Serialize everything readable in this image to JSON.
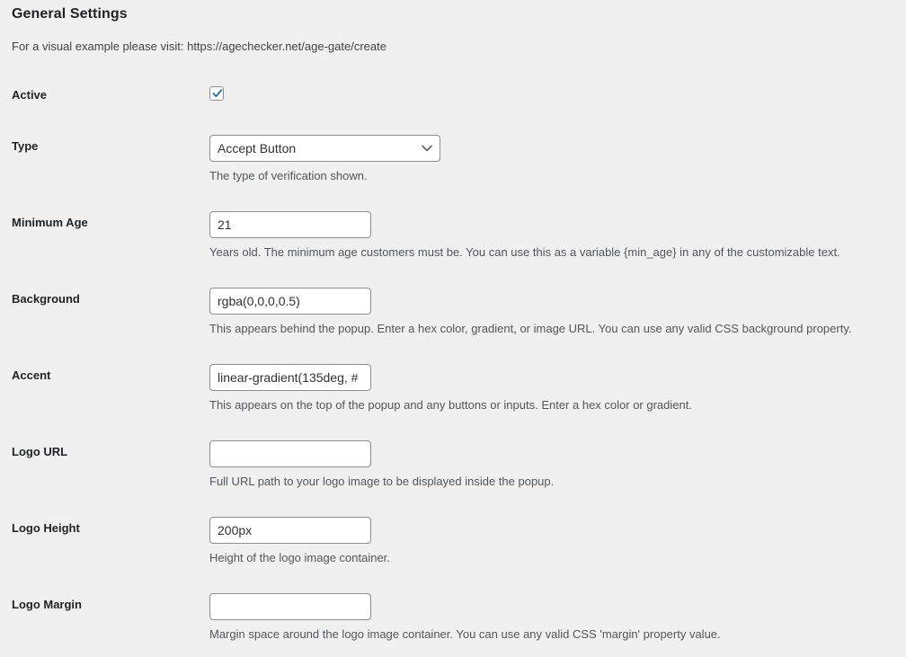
{
  "header": {
    "title": "General Settings",
    "subtitle": "For a visual example please visit: https://agechecker.net/age-gate/create"
  },
  "colors": {
    "background": "#f0f0f1",
    "label_text": "#1d2327",
    "description_text": "#50575e",
    "input_border": "#8c8f94",
    "input_background": "#ffffff",
    "checkbox_accent": "#2271b1"
  },
  "fields": [
    {
      "label": "Active",
      "control": "checkbox",
      "checked": true,
      "value": "",
      "description": ""
    },
    {
      "label": "Type",
      "control": "select",
      "value": "Accept Button",
      "options": [
        "Accept Button"
      ],
      "description": "The type of verification shown."
    },
    {
      "label": "Minimum Age",
      "control": "text",
      "value": "21",
      "placeholder": "",
      "description": "Years old. The minimum age customers must be. You can use this as a variable {min_age} in any of the customizable text."
    },
    {
      "label": "Background",
      "control": "text",
      "value": "rgba(0,0,0,0.5)",
      "placeholder": "",
      "description": "This appears behind the popup. Enter a hex color, gradient, or image URL. You can use any valid CSS background property."
    },
    {
      "label": "Accent",
      "control": "text",
      "value": "linear-gradient(135deg, #",
      "placeholder": "",
      "description": "This appears on the top of the popup and any buttons or inputs. Enter a hex color or gradient."
    },
    {
      "label": "Logo URL",
      "control": "text",
      "value": "",
      "placeholder": "",
      "description": "Full URL path to your logo image to be displayed inside the popup."
    },
    {
      "label": "Logo Height",
      "control": "text",
      "value": "200px",
      "placeholder": "",
      "description": "Height of the logo image container."
    },
    {
      "label": "Logo Margin",
      "control": "text",
      "value": "",
      "placeholder": "",
      "description": "Margin space around the logo image container. You can use any valid CSS 'margin' property value."
    }
  ]
}
